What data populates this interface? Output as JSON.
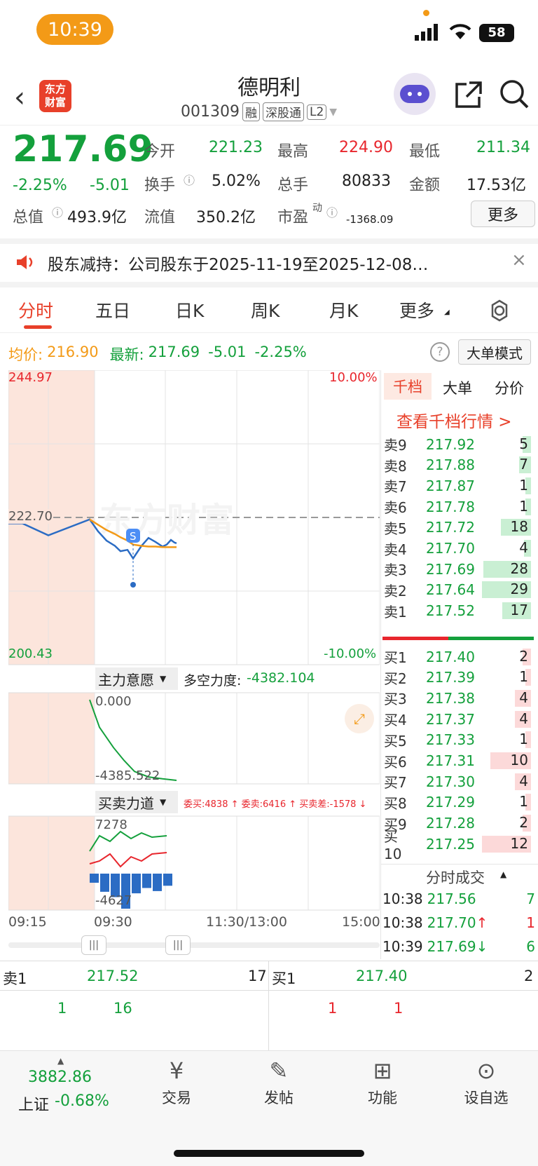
{
  "status": {
    "time": "10:39",
    "battery": "58"
  },
  "header": {
    "title": "德明利",
    "code": "001309",
    "tags": [
      "融",
      "深股通",
      "L2"
    ],
    "logo_text": "东方财富"
  },
  "quote": {
    "price": "217.69",
    "pct": "-2.25%",
    "change": "-5.01",
    "rows": [
      [
        {
          "label": "今开",
          "value": "221.23",
          "color": "green"
        },
        {
          "label": "最高",
          "value": "224.90",
          "color": "red"
        },
        {
          "label": "最低",
          "value": "211.34",
          "color": "green"
        }
      ],
      [
        {
          "label": "换手",
          "value": "5.02%",
          "color": "black"
        },
        {
          "label": "总手",
          "value": "80833",
          "color": "black"
        },
        {
          "label": "金额",
          "value": "17.53亿",
          "color": "black"
        }
      ],
      [
        {
          "label": "总值",
          "value": "493.9亿",
          "color": "black"
        },
        {
          "label": "流值",
          "value": "350.2亿",
          "color": "black"
        },
        {
          "label": "市盈",
          "value": "-1368.09",
          "color": "black"
        }
      ]
    ],
    "pe_sup": "动",
    "more": "更多"
  },
  "notice": "股东减持：公司股东于2025-11-19至2025-12-08…",
  "tabs": [
    "分时",
    "五日",
    "日K",
    "周K",
    "月K",
    "更多"
  ],
  "info_line": {
    "avg_label": "均价:",
    "avg": "216.90",
    "latest_label": "最新:",
    "latest": "217.69",
    "chg": "-5.01",
    "pct": "-2.25%",
    "mode": "大单模式"
  },
  "chart": {
    "top_price": "244.97",
    "mid_price": "222.70",
    "bottom_price": "200.43",
    "top_pct": "10.00%",
    "bottom_pct": "-10.00%",
    "time_labels": [
      "09:15",
      "09:30",
      "11:30/13:00",
      "15:00"
    ],
    "watermark": "东方财富"
  },
  "chart_data": [
    {
      "type": "line",
      "x": [
        "09:15",
        "09:20",
        "09:25",
        "09:30",
        "09:35",
        "09:40",
        "09:45",
        "09:50",
        "09:55",
        "10:00",
        "10:05",
        "10:10",
        "10:15",
        "10:20",
        "10:25",
        "10:30",
        "10:35",
        "10:39"
      ],
      "series": [
        {
          "values": [
            221.8,
            221.8,
            220.0,
            222.4,
            220.6,
            219.2,
            218.4,
            217.6,
            217.8,
            216.5,
            218.4,
            219.6,
            219.0,
            218.3,
            218.6,
            219.3,
            218.9,
            218.8
          ]
        },
        {
          "values": [
            null,
            null,
            null,
            222.4,
            221.6,
            220.8,
            220.2,
            219.7,
            219.2,
            218.6,
            218.4,
            218.3,
            218.3,
            218.2,
            218.2,
            218.2,
            218.2,
            218.2
          ]
        }
      ],
      "ylim": [
        200.43,
        244.97
      ]
    },
    {
      "type": "line",
      "series": [
        {
          "values": [
            0,
            -1500,
            -2600,
            -3300,
            -3900,
            -4200,
            -4300,
            -4385.522
          ]
        }
      ],
      "ylim": [
        -4385.522,
        0
      ]
    },
    {
      "type": "bar",
      "series": [
        {
          "values": [
            -1200,
            -2400,
            -3100,
            -4627,
            -2600,
            -1900,
            -2300,
            -1600
          ]
        }
      ],
      "ylim": [
        -4627,
        7278
      ]
    }
  ],
  "sub1": {
    "title": "主力意愿",
    "label": "多空力度:",
    "value": "-4382.104",
    "top": "0.000",
    "bottom": "-4385.522"
  },
  "sub2": {
    "title": "买卖力道",
    "text": "委买:4838 ↑ 委卖:6416 ↑ 买卖差:-1578 ↓",
    "top": "7278",
    "bottom": "-4627"
  },
  "book_tabs": [
    "千档",
    "大单",
    "分价"
  ],
  "book_link": "查看千档行情 >",
  "asks": [
    {
      "label": "卖9",
      "price": "217.92",
      "vol": "5"
    },
    {
      "label": "卖8",
      "price": "217.88",
      "vol": "7"
    },
    {
      "label": "卖7",
      "price": "217.87",
      "vol": "1"
    },
    {
      "label": "卖6",
      "price": "217.78",
      "vol": "1"
    },
    {
      "label": "卖5",
      "price": "217.72",
      "vol": "18"
    },
    {
      "label": "卖4",
      "price": "217.70",
      "vol": "4"
    },
    {
      "label": "卖3",
      "price": "217.69",
      "vol": "28"
    },
    {
      "label": "卖2",
      "price": "217.64",
      "vol": "29"
    },
    {
      "label": "卖1",
      "price": "217.52",
      "vol": "17"
    }
  ],
  "bids": [
    {
      "label": "买1",
      "price": "217.40",
      "vol": "2"
    },
    {
      "label": "买2",
      "price": "217.39",
      "vol": "1"
    },
    {
      "label": "买3",
      "price": "217.38",
      "vol": "4"
    },
    {
      "label": "买4",
      "price": "217.37",
      "vol": "4"
    },
    {
      "label": "买5",
      "price": "217.33",
      "vol": "1"
    },
    {
      "label": "买6",
      "price": "217.31",
      "vol": "10"
    },
    {
      "label": "买7",
      "price": "217.30",
      "vol": "4"
    },
    {
      "label": "买8",
      "price": "217.29",
      "vol": "1"
    },
    {
      "label": "买9",
      "price": "217.28",
      "vol": "2"
    },
    {
      "label": "买10",
      "price": "217.25",
      "vol": "12"
    }
  ],
  "trades_title": "分时成交",
  "trades": [
    {
      "time": "10:38",
      "price": "217.56",
      "arrow": "",
      "vol": "7"
    },
    {
      "time": "10:38",
      "price": "217.70",
      "arrow": "↑",
      "vol": "1"
    },
    {
      "time": "10:39",
      "price": "217.69",
      "arrow": "↓",
      "vol": "6"
    }
  ],
  "bottom_book": {
    "sell_label": "卖1",
    "sell_price": "217.52",
    "sell_vol": "17",
    "buy_label": "买1",
    "buy_price": "217.40",
    "buy_vol": "2",
    "sell_orders": [
      "1",
      "16"
    ],
    "buy_orders": [
      "1",
      "1"
    ]
  },
  "nav": {
    "index_value": "3882.86",
    "index_label": "上证",
    "index_pct": "-0.68%",
    "items": [
      {
        "label": "交易",
        "icon": "exchange-icon"
      },
      {
        "label": "发帖",
        "icon": "edit-icon"
      },
      {
        "label": "功能",
        "icon": "grid-icon"
      },
      {
        "label": "设自选",
        "icon": "more-icon"
      }
    ]
  },
  "colors": {
    "up": "#e8262d",
    "down": "#14a03c",
    "accent": "#f39a17",
    "line": "#2b6cc4",
    "avg": "#f39a17"
  }
}
